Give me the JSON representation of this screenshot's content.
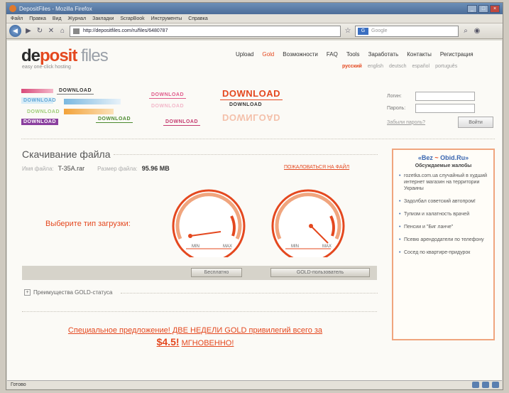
{
  "browser": {
    "title": "DepositFiles - Mozilla Firefox",
    "menu": [
      "Файл",
      "Правка",
      "Вид",
      "Журнал",
      "Закладки",
      "ScrapBook",
      "Инструменты",
      "Справка"
    ],
    "url": "http://depositfiles.com/ru/files/6480787",
    "search_placeholder": "Google",
    "status": "Готово"
  },
  "site": {
    "logo_a": "de",
    "logo_p": "posit",
    "logo_f": " files",
    "tagline": "easy one-click hosting",
    "nav": [
      "Upload",
      "Gold",
      "Возможности",
      "FAQ",
      "Tools",
      "Заработать",
      "Контакты",
      "Регистрация"
    ],
    "langs": [
      "русский",
      "english",
      "deutsch",
      "español",
      "português"
    ],
    "banner_word": "DOWNLOAD"
  },
  "login": {
    "login_label": "Логин:",
    "password_label": "Пароль:",
    "forgot": "Забыли пароль?",
    "submit": "Войти"
  },
  "download": {
    "title": "Скачивание файла",
    "filename_label": "Имя файла:",
    "filename": "T-35A.rar",
    "filesize_label": "Размер файла:",
    "filesize": "95.96 MB",
    "complain": "ПОЖАЛОВАТЬСЯ НА ФАЙЛ",
    "choose": "Выберите тип загрузки:",
    "gauge_min": "MIN",
    "gauge_max": "MAX",
    "free_button": "Бесплатно",
    "gold_button": "GOLD-пользователь",
    "gold_adv": "Преимущества GOLD-статуса",
    "offer_line1": "Специальное предложение! ДВЕ НЕДЕЛИ GOLD привилегий всего за",
    "offer_price": "$4.5!",
    "offer_now": "МГНОВЕННО!"
  },
  "sidebar": {
    "brand_a": "«Bez",
    "brand_b": " ~ ",
    "brand_c": "Obid.Ru»",
    "subtitle": "Обсуждаемые жалобы",
    "items": [
      "rozetka.com.ua случайный в худший интернет магазин на территории Украины",
      "Задолбал советский автопром!",
      "Тупизм и халатность врачей",
      "Пенсии и \"Биг ланче\"",
      "Псевю арендодатели по телефону",
      "Сосед по квартире-придурок"
    ]
  },
  "colors": {
    "accent": "#e4481f",
    "link_blue": "#3a66b0",
    "sidebar_border": "#f0a57e"
  }
}
